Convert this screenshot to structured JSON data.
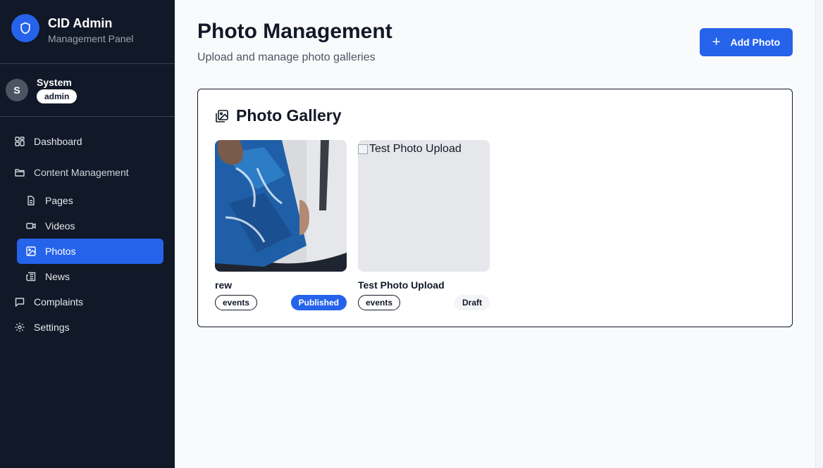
{
  "brand": {
    "title": "CID Admin",
    "subtitle": "Management Panel",
    "logo_icon": "shield-icon"
  },
  "user": {
    "initial": "S",
    "name": "System",
    "role": "admin"
  },
  "nav": {
    "dashboard": "Dashboard",
    "content_management": "Content Management",
    "pages": "Pages",
    "videos": "Videos",
    "photos": "Photos",
    "news": "News",
    "complaints": "Complaints",
    "settings": "Settings"
  },
  "header": {
    "title": "Photo Management",
    "subtitle": "Upload and manage photo galleries",
    "add_button": "Add Photo"
  },
  "gallery": {
    "title": "Photo Gallery",
    "photos": [
      {
        "title": "rew",
        "category": "events",
        "status": "Published"
      },
      {
        "title": "Test Photo Upload",
        "category": "events",
        "status": "Draft",
        "alt_text": "Test Photo Upload"
      }
    ]
  },
  "colors": {
    "sidebar": "#111827",
    "accent": "#2563eb",
    "page_bg": "#f9fafb"
  }
}
